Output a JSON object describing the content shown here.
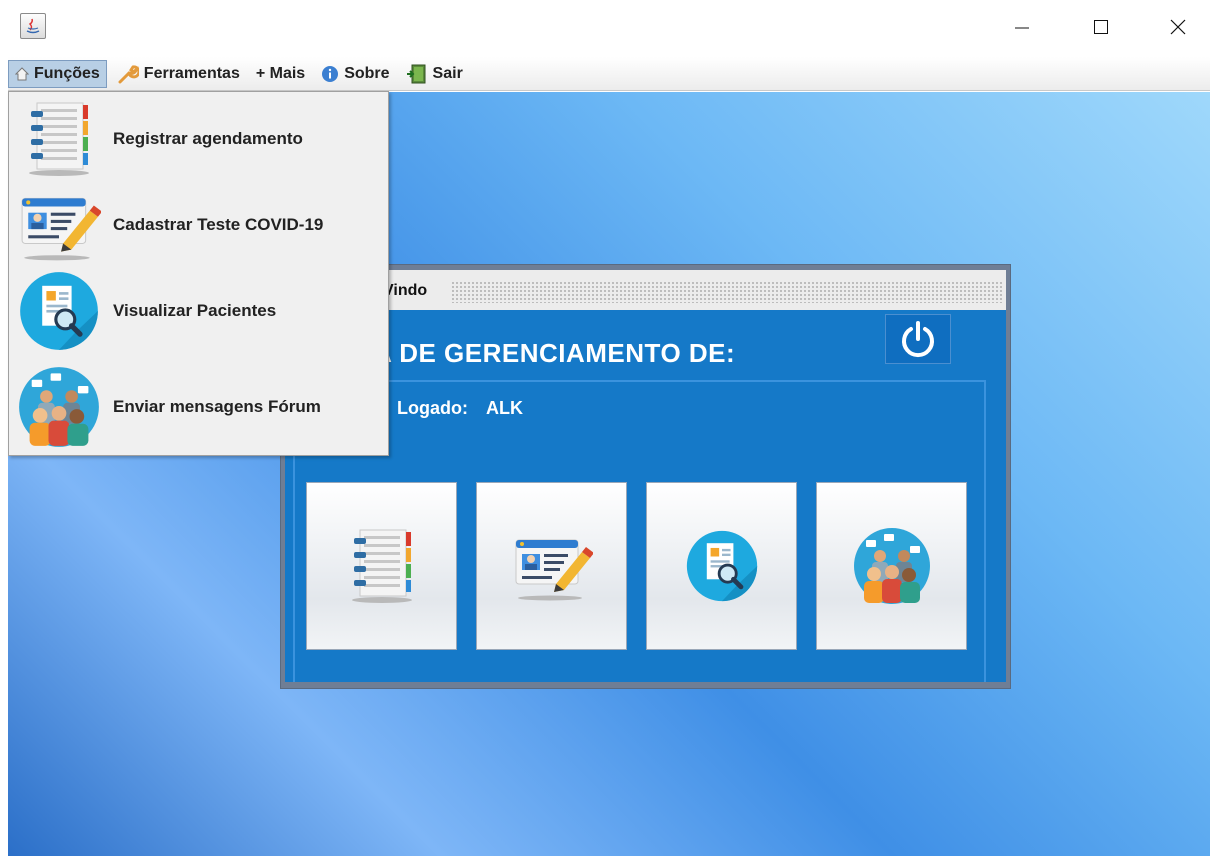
{
  "window": {
    "minimize_glyph": "—",
    "maximize_glyph": "☐",
    "close_glyph": "✕"
  },
  "menubar": {
    "items": [
      {
        "label": "Funções",
        "icon": "home-icon",
        "active": true
      },
      {
        "label": "Ferramentas",
        "icon": "wrench-icon"
      },
      {
        "label": "+ Mais",
        "icon": "plus-icon"
      },
      {
        "label": "Sobre",
        "icon": "info-icon"
      },
      {
        "label": "Sair",
        "icon": "exit-door-icon"
      }
    ]
  },
  "popup_menu": {
    "items": [
      {
        "label": "Registrar agendamento",
        "icon": "notebook-icon"
      },
      {
        "label": "Cadastrar Teste COVID-19",
        "icon": "id-card-pencil-icon"
      },
      {
        "label": "Visualizar Pacientes",
        "icon": "document-search-icon"
      },
      {
        "label": "Enviar mensagens Fórum",
        "icon": "group-chat-icon"
      }
    ]
  },
  "internal_frame": {
    "title": "Vindo",
    "heading": "MA DE GERENCIAMENTO DE:",
    "logged_label": "Logado:",
    "logged_user": "ALK",
    "power_icon": "power-icon",
    "buttons": [
      {
        "icon": "notebook-icon"
      },
      {
        "icon": "id-card-pencil-icon"
      },
      {
        "icon": "document-search-icon"
      },
      {
        "icon": "group-chat-icon"
      }
    ]
  },
  "colors": {
    "desktop_light": "#9fd8fb",
    "desktop_dark": "#2b6fc8",
    "frame_body": "#1579c8",
    "menu_active": "#b8cfe5"
  }
}
